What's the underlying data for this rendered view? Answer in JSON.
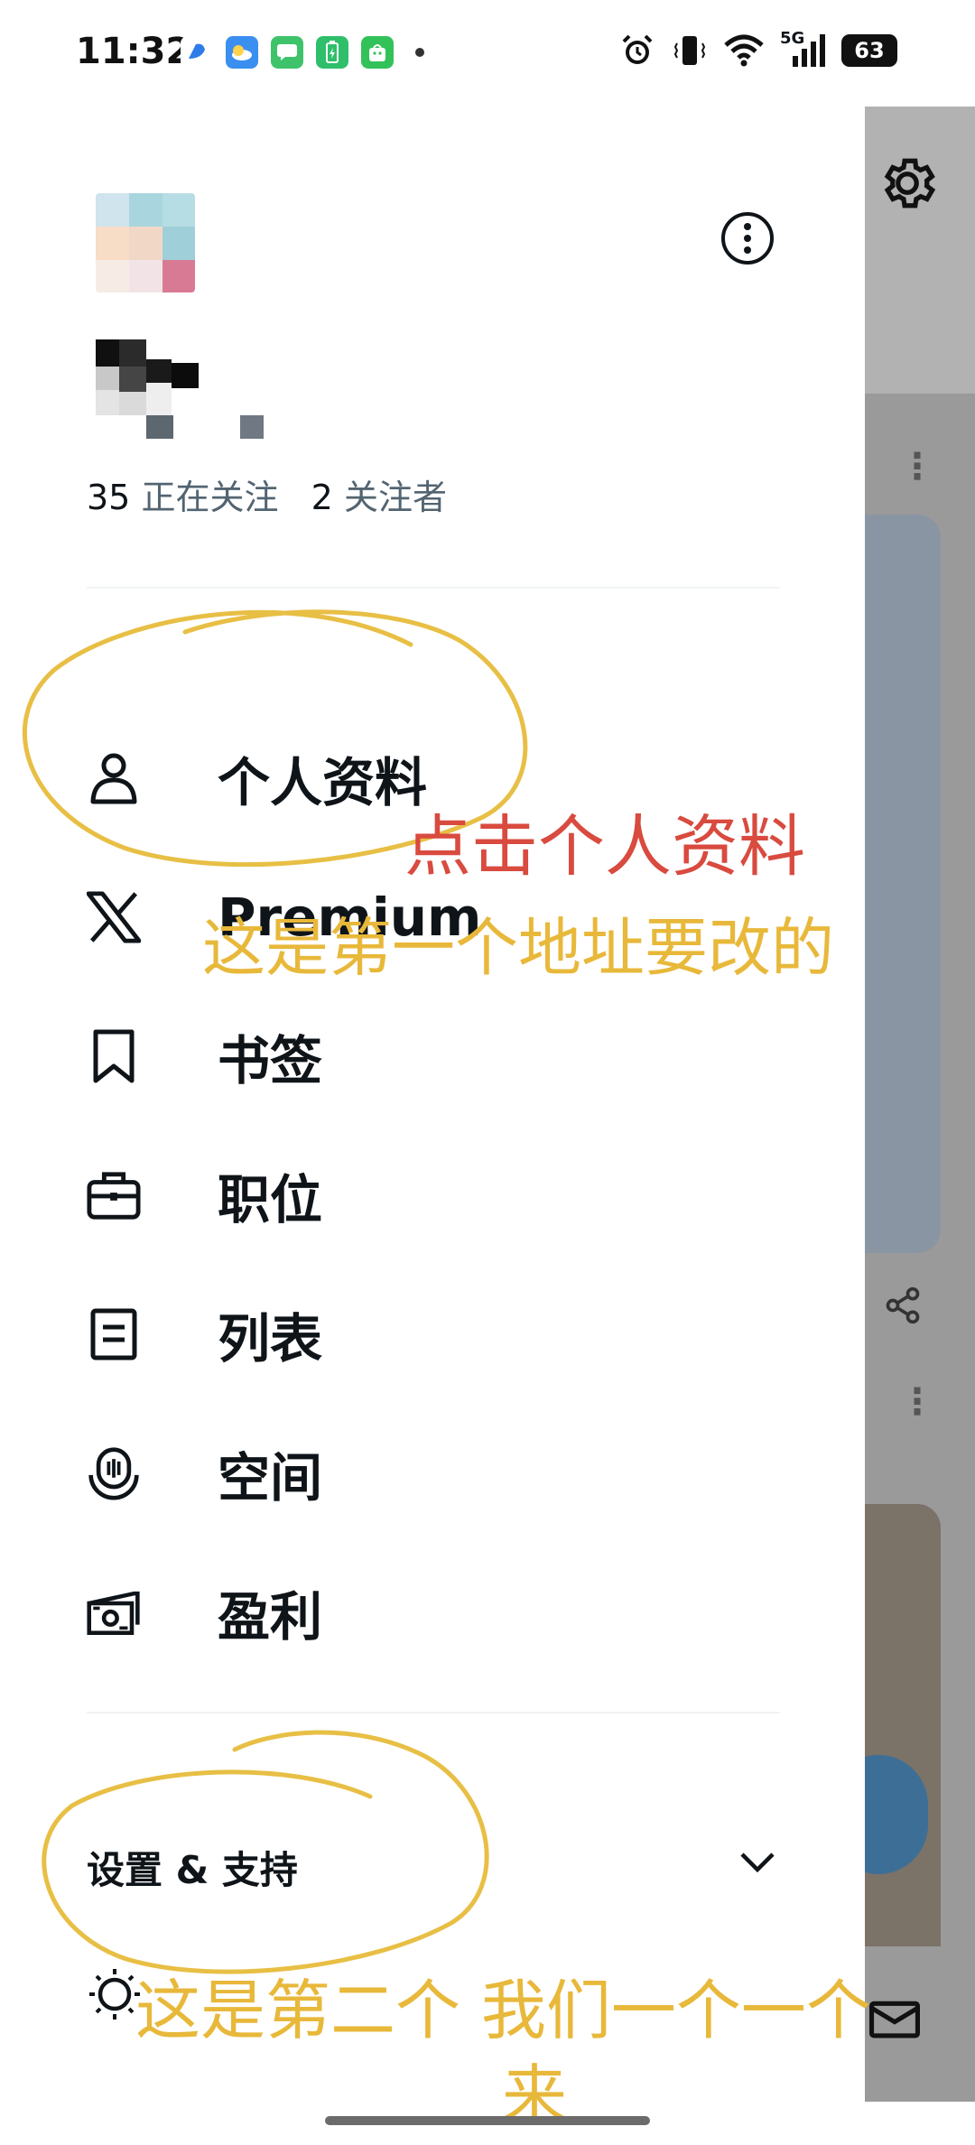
{
  "status_bar": {
    "time": "11:32",
    "network": "5G",
    "battery": "63",
    "notification_icons": [
      "bubble-icon",
      "weather-icon",
      "messages-icon",
      "battery-saver-icon",
      "store-icon"
    ],
    "system_icons": [
      "alarm-icon",
      "vibrate-icon",
      "wifi-icon",
      "signal-icon"
    ]
  },
  "drawer": {
    "follow": {
      "following_count": "35",
      "following_label": "正在关注",
      "followers_count": "2",
      "followers_label": "关注者"
    },
    "menu": [
      {
        "id": "profile",
        "label": "个人资料",
        "icon": "person-icon"
      },
      {
        "id": "premium",
        "label": "Premium",
        "icon": "x-logo-icon"
      },
      {
        "id": "bookmarks",
        "label": "书签",
        "icon": "bookmark-icon"
      },
      {
        "id": "jobs",
        "label": "职位",
        "icon": "briefcase-icon"
      },
      {
        "id": "lists",
        "label": "列表",
        "icon": "list-icon"
      },
      {
        "id": "spaces",
        "label": "空间",
        "icon": "spaces-icon"
      },
      {
        "id": "monetization",
        "label": "盈利",
        "icon": "money-icon"
      }
    ],
    "settings_support": "设置 & 支持"
  },
  "annotations": {
    "click_profile": "点击个人资料",
    "first_address": "这是第一个地址要改的",
    "second_line1": "这是第二个 我们一个一个",
    "second_line2": "来"
  },
  "colors": {
    "text": "#0f1419",
    "muted": "#536471",
    "annotation_red": "#d94a3f",
    "annotation_yellow": "#e8b83a",
    "background_app_overlay": "#9a9a9a"
  }
}
